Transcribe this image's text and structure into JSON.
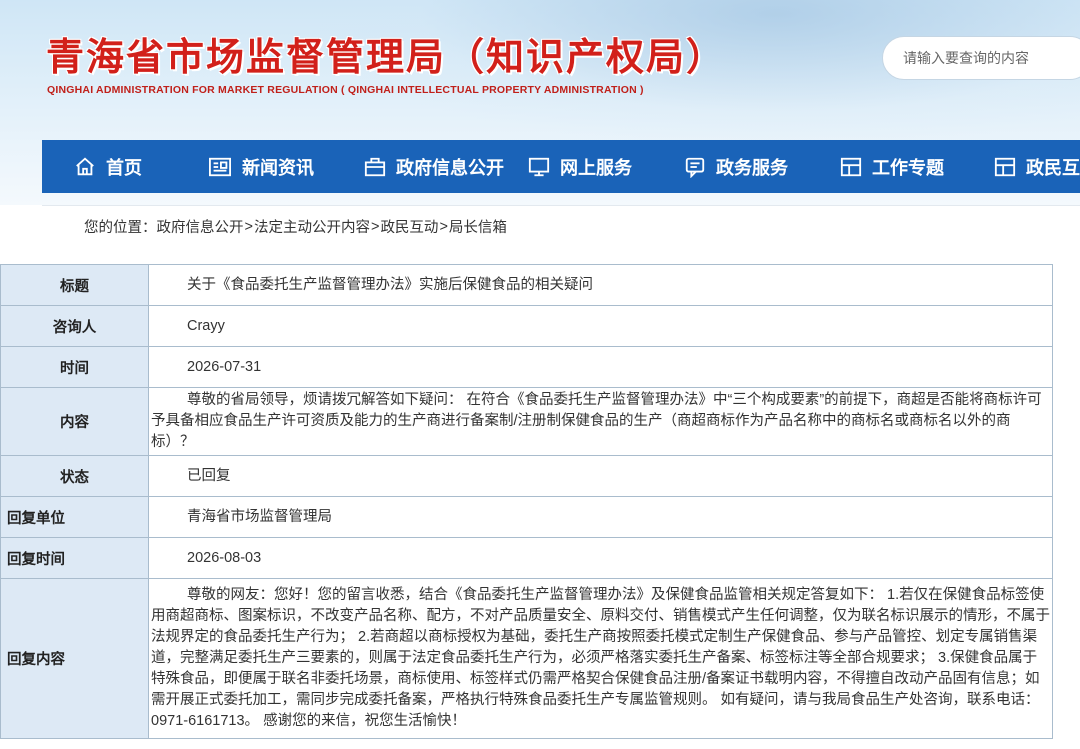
{
  "header": {
    "title": "青海省市场监督管理局（知识产权局）",
    "subtitle": "QINGHAI ADMINISTRATION FOR MARKET REGULATION ( QINGHAI INTELLECTUAL PROPERTY ADMINISTRATION )",
    "search_placeholder": "请输入要查询的内容",
    "search_icon": "search-icon"
  },
  "nav": {
    "items": [
      {
        "label": "首页",
        "icon": "home-icon"
      },
      {
        "label": "新闻资讯",
        "icon": "news-icon"
      },
      {
        "label": "政府信息公开",
        "icon": "briefcase-icon"
      },
      {
        "label": "网上服务",
        "icon": "monitor-icon"
      },
      {
        "label": "政务服务",
        "icon": "chat-icon"
      },
      {
        "label": "工作专题",
        "icon": "topic-icon"
      },
      {
        "label": "政民互动",
        "icon": "interaction-icon"
      }
    ],
    "bg_color": "#1a63b8"
  },
  "breadcrumb": {
    "prefix": "您的位置：",
    "items": [
      "政府信息公开",
      "法定主动公开内容",
      "政民互动",
      "局长信箱"
    ],
    "separator": ">"
  },
  "detail": {
    "rows": [
      {
        "label": "标题",
        "value": "关于《食品委托生产监督管理办法》实施后保健食品的相关疑问"
      },
      {
        "label": "咨询人",
        "value": "Crayy"
      },
      {
        "label": "时间",
        "value": "2026-07-31"
      },
      {
        "label": "内容",
        "value": "尊敬的省局领导，烦请拨冗解答如下疑问：  在符合《食品委托生产监督管理办法》中“三个构成要素”的前提下，商超是否能将商标许可予具备相应食品生产许可资质及能力的生产商进行备案制/注册制保健食品的生产（商超商标作为产品名称中的商标名或商标名以外的商标）？"
      },
      {
        "label": "状态",
        "value": "已回复"
      },
      {
        "label": "回复单位",
        "value": "青海省市场监督管理局"
      },
      {
        "label": "回复时间",
        "value": "2026-08-03"
      },
      {
        "label": "回复内容",
        "value": "尊敬的网友：您好！您的留言收悉，结合《食品委托生产监督管理办法》及保健食品监管相关规定答复如下：  1.若仅在保健食品标签使用商超商标、图案标识，不改变产品名称、配方，不对产品质量安全、原料交付、销售模式产生任何调整，仅为联名标识展示的情形，不属于法规界定的食品委托生产行为；  2.若商超以商标授权为基础，委托生产商按照委托模式定制生产保健食品、参与产品管控、划定专属销售渠道，完整满足委托生产三要素的，则属于法定食品委托生产行为，必须严格落实委托生产备案、标签标注等全部合规要求；  3.保健食品属于特殊食品，即便属于联名非委托场景，商标使用、标签样式仍需严格契合保健食品注册/备案证书载明内容，不得擅自改动产品固有信息；如需开展正式委托加工，需同步完成委托备案，严格执行特殊食品委托生产专属监管规则。  如有疑问，请与我局食品生产处咨询，联系电话：0971-6161713。  感谢您的来信，祝您生活愉快！"
      }
    ]
  }
}
